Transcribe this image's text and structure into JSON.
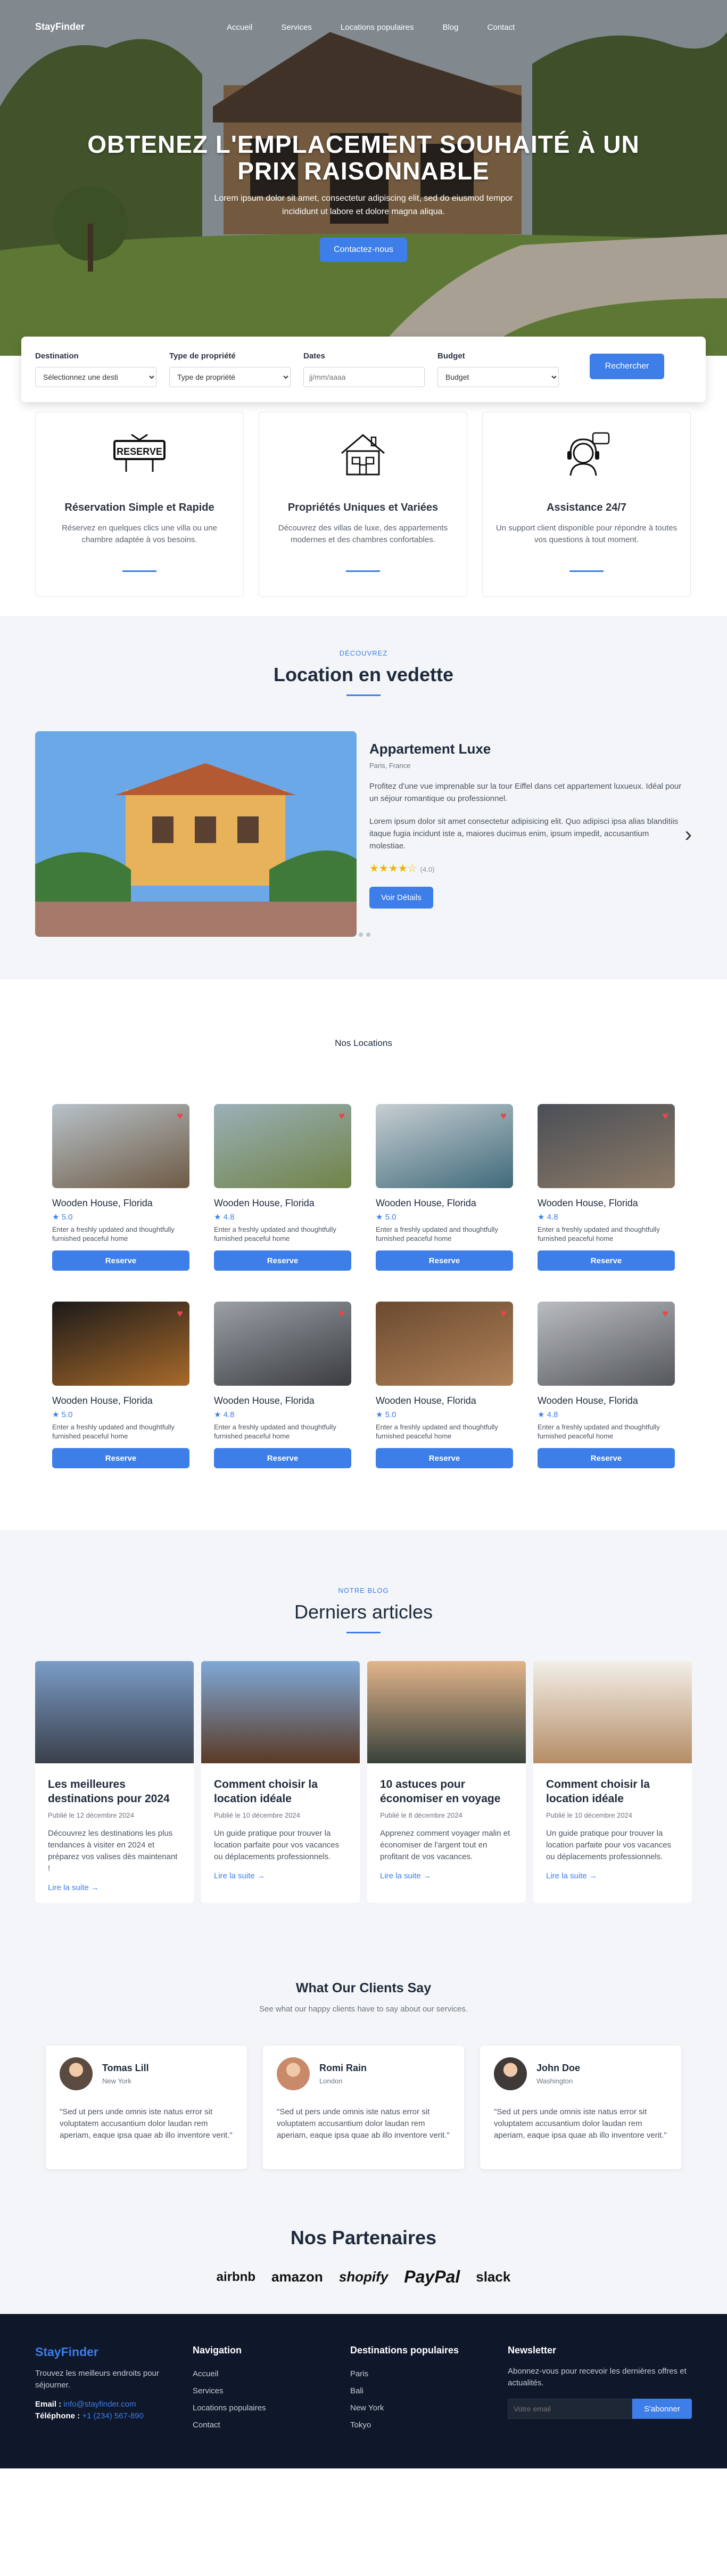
{
  "brand": "StayFinder",
  "nav": [
    "Accueil",
    "Services",
    "Locations populaires",
    "Blog",
    "Contact"
  ],
  "hero": {
    "title": "OBTENEZ L'EMPLACEMENT SOUHAITÉ À UN PRIX RAISONNABLE",
    "subtitle_line1": "Lorem ipsum dolor sit amet, consectetur adipiscing elit, sed do eiusmod tempor",
    "subtitle_line2": "incididunt ut labore et dolore magna aliqua.",
    "cta": "Contactez-nous"
  },
  "search": {
    "destination_label": "Destination",
    "destination_value": "Sélectionnez une desti",
    "type_label": "Type de propriété",
    "type_value": "Type de propriété",
    "dates_label": "Dates",
    "dates_placeholder": "jj/mm/aaaa",
    "budget_label": "Budget",
    "budget_value": "Budget",
    "button": "Rechercher"
  },
  "features": [
    {
      "title": "Réservation Simple et Rapide",
      "text": "Réservez en quelques clics une villa ou une chambre adaptée à vos besoins.",
      "icon": "reserve-sign-icon",
      "icon_text": "RESERVE"
    },
    {
      "title": "Propriétés Uniques et Variées",
      "text": "Découvrez des villas de luxe, des appartements modernes et des chambres confortables.",
      "icon": "house-icon"
    },
    {
      "title": "Assistance 24/7",
      "text": "Un support client disponible pour répondre à toutes vos questions à tout moment.",
      "icon": "support-agent-icon"
    }
  ],
  "featured": {
    "eyebrow": "DÉCOUVREZ",
    "title": "Location en vedette",
    "name": "Appartement Luxe",
    "location": "Paris, France",
    "desc1": "Profitez d'une vue imprenable sur la tour Eiffel dans cet appartement luxueux. Idéal pour un séjour romantique ou professionnel.",
    "desc2": "Lorem ipsum dolor sit amet consectetur adipisicing elit. Quo adipisci ipsa alias blanditiis itaque fugia incidunt iste a, maiores ducimus enim, ipsum impedit, accusantium molestiae.",
    "stars": 4,
    "rating": "(4.0)",
    "button": "Voir Détails"
  },
  "locations": {
    "title": "Nos Locations",
    "items": [
      {
        "name": "Wooden House, Florida",
        "rating": "5.0",
        "desc": "Enter a freshly updated and thoughtfully furnished peaceful home",
        "button": "Reserve",
        "c1": "#b7c2c9",
        "c2": "#6e5a44"
      },
      {
        "name": "Wooden House, Florida",
        "rating": "4.8",
        "desc": "Enter a freshly updated and thoughtfully furnished peaceful home",
        "button": "Reserve",
        "c1": "#9bb0b8",
        "c2": "#6f8347"
      },
      {
        "name": "Wooden House, Florida",
        "rating": "5.0",
        "desc": "Enter a freshly updated and thoughtfully furnished peaceful home",
        "button": "Reserve",
        "c1": "#c7ced2",
        "c2": "#3f6a7a"
      },
      {
        "name": "Wooden House, Florida",
        "rating": "4.8",
        "desc": "Enter a freshly updated and thoughtfully furnished peaceful home",
        "button": "Reserve",
        "c1": "#4a4f57",
        "c2": "#8c7a66"
      },
      {
        "name": "Wooden House, Florida",
        "rating": "5.0",
        "desc": "Enter a freshly updated and thoughtfully furnished peaceful home",
        "button": "Reserve",
        "c1": "#1c1a1a",
        "c2": "#a86a2a"
      },
      {
        "name": "Wooden House, Florida",
        "rating": "4.8",
        "desc": "Enter a freshly updated and thoughtfully furnished peaceful home",
        "button": "Reserve",
        "c1": "#9aa0a6",
        "c2": "#3a3c40"
      },
      {
        "name": "Wooden House, Florida",
        "rating": "5.0",
        "desc": "Enter a freshly updated and thoughtfully furnished peaceful home",
        "button": "Reserve",
        "c1": "#6b4a30",
        "c2": "#b08258"
      },
      {
        "name": "Wooden House, Florida",
        "rating": "4.8",
        "desc": "Enter a freshly updated and thoughtfully furnished peaceful home",
        "button": "Reserve",
        "c1": "#b9bcc0",
        "c2": "#54575c"
      }
    ]
  },
  "blog": {
    "eyebrow": "NOTRE BLOG",
    "title": "Derniers articles",
    "posts": [
      {
        "title": "Les meilleures destinations pour 2024",
        "date": "Publié le 12 décembre 2024",
        "text": "Découvrez les destinations les plus tendances à visiter en 2024 et préparez vos valises dès maintenant !",
        "link": "Lire la suite →",
        "c1": "#7a9cc7",
        "c2": "#3a3f4a"
      },
      {
        "title": "Comment choisir la location idéale",
        "date": "Publié le 10 décembre 2024",
        "text": "Un guide pratique pour trouver la location parfaite pour vos vacances ou déplacements professionnels.",
        "link": "Lire la suite →",
        "c1": "#7fa9d8",
        "c2": "#5b3a26"
      },
      {
        "title": "10 astuces pour économiser en voyage",
        "date": "Publié le 8 décembre 2024",
        "text": "Apprenez comment voyager malin et économiser de l'argent tout en profitant de vos vacances.",
        "link": "Lire la suite →",
        "c1": "#e2b48a",
        "c2": "#37423b"
      },
      {
        "title": "Comment choisir la location idéale",
        "date": "Publié le 10 décembre 2024",
        "text": "Un guide pratique pour trouver la location parfaite pour vos vacances ou déplacements professionnels.",
        "link": "Lire la suite →",
        "c1": "#f2efe8",
        "c2": "#b58d66"
      }
    ]
  },
  "testimonials": {
    "title": "What Our Clients Say",
    "subtitle": "See what our happy clients have to say about our services.",
    "items": [
      {
        "name": "Tomas Lill",
        "city": "New York",
        "text": "\"Sed ut pers unde omnis iste natus error sit voluptatem accusantium dolor laudan rem aperiam, eaque ipsa quae ab illo inventore verit.\""
      },
      {
        "name": "Romi Rain",
        "city": "London",
        "text": "\"Sed ut pers unde omnis iste natus error sit voluptatem accusantium dolor laudan rem aperiam, eaque ipsa quae ab illo inventore verit.\""
      },
      {
        "name": "John Doe",
        "city": "Washington",
        "text": "\"Sed ut pers unde omnis iste natus error sit voluptatem accusantium dolor laudan rem aperiam, eaque ipsa quae ab illo inventore verit.\""
      }
    ]
  },
  "partners": {
    "title": "Nos Partenaires",
    "logos": [
      "airbnb",
      "amazon",
      "shopify",
      "PayPal",
      "slack"
    ]
  },
  "footer": {
    "brand": "StayFinder",
    "tagline": "Trouvez les meilleurs endroits pour séjourner.",
    "email_label": "Email :",
    "email": "info@stayfinder.com",
    "phone_label": "Téléphone :",
    "phone": "+1 (234) 567-890",
    "nav_title": "Navigation",
    "nav": [
      "Accueil",
      "Services",
      "Locations populaires",
      "Contact"
    ],
    "dest_title": "Destinations populaires",
    "dest": [
      "Paris",
      "Bali",
      "New York",
      "Tokyo"
    ],
    "news_title": "Newsletter",
    "news_text": "Abonnez-vous pour recevoir les dernières offres et actualités.",
    "news_placeholder": "Votre email",
    "news_button": "S'abonner"
  },
  "colors": {
    "accent": "#3d7ee8",
    "footer_bg": "#0f172a",
    "heart": "#e5484d",
    "star": "#f5b301"
  }
}
